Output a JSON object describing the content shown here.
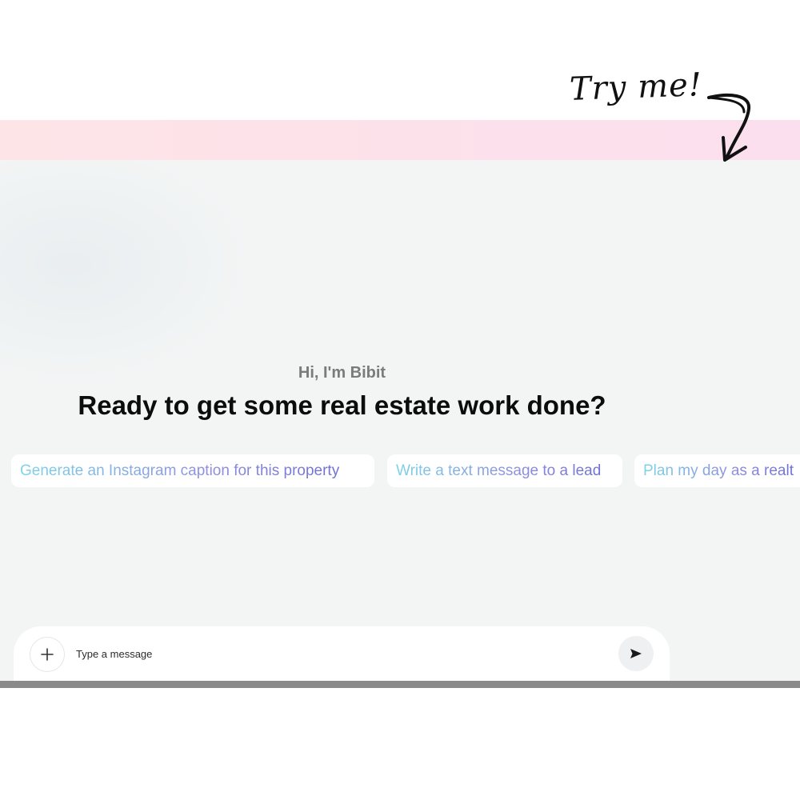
{
  "callout": {
    "text": "Try me!"
  },
  "chat": {
    "greeting": "Hi, I'm Bibit",
    "headline": "Ready to get some real estate work done?",
    "suggestions": [
      "Generate an Instagram caption for this property",
      "Write a text message to a lead",
      "Plan my day as a realt"
    ]
  },
  "composer": {
    "placeholder": "Type a message",
    "add_icon": "plus-icon",
    "send_icon": "send-icon"
  },
  "colors": {
    "band_start": "#fde5e7",
    "band_end": "#fbdfee",
    "panel_bg": "#f3f5f5",
    "chip_gradient_start": "#7dd3e6",
    "chip_gradient_end": "#6f6fd4"
  }
}
